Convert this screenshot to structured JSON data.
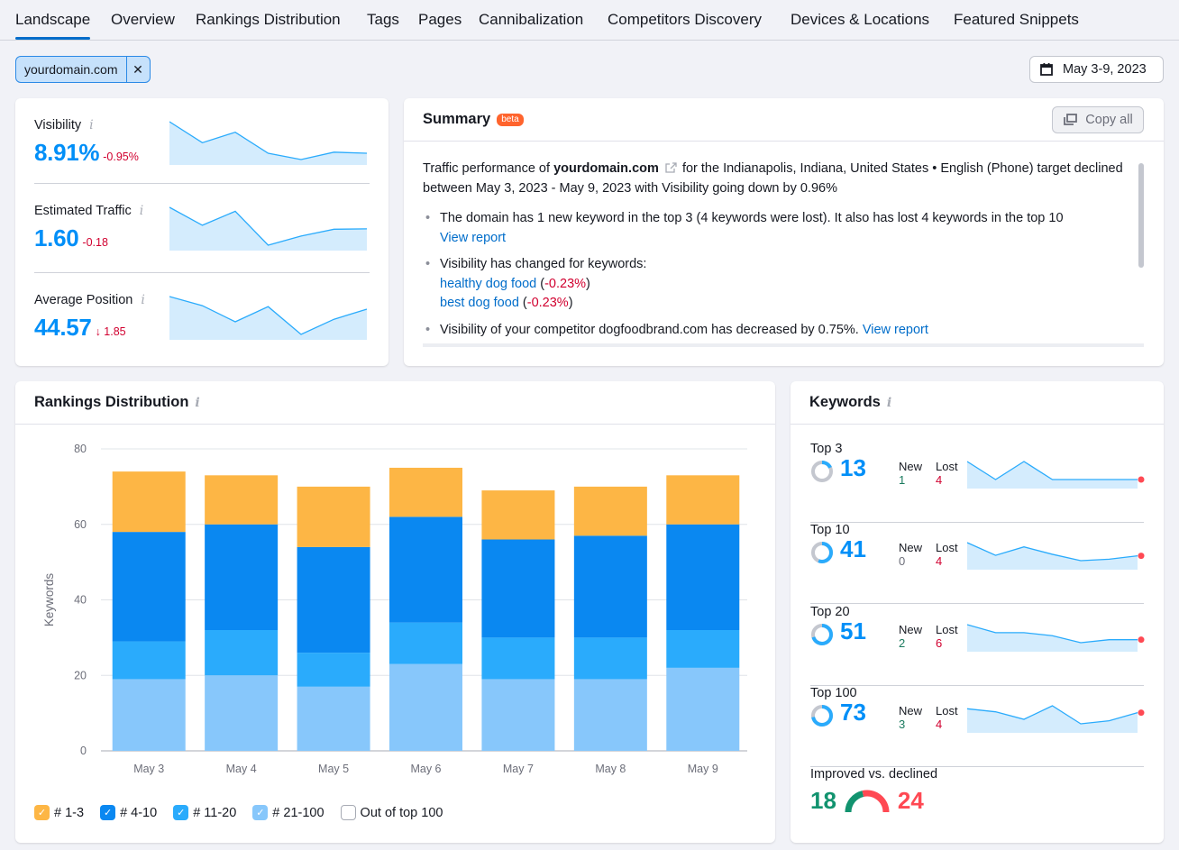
{
  "tabs": [
    {
      "label": "Landscape",
      "active": true
    },
    {
      "label": "Overview",
      "active": false
    },
    {
      "label": "Rankings Distribution",
      "active": false
    },
    {
      "label": "Tags",
      "active": false
    },
    {
      "label": "Pages",
      "active": false
    },
    {
      "label": "Cannibalization",
      "active": false
    },
    {
      "label": "Competitors Discovery",
      "active": false
    },
    {
      "label": "Devices & Locations",
      "active": false
    },
    {
      "label": "Featured Snippets",
      "active": false
    }
  ],
  "filter": {
    "domain": "yourdomain.com",
    "close_icon": "close-icon"
  },
  "date_range": {
    "label": "May 3-9, 2023",
    "icon": "calendar-icon"
  },
  "metrics": [
    {
      "label": "Visibility",
      "value": "8.91%",
      "delta": "-0.95%",
      "trend": [
        100,
        60,
        80,
        40,
        28,
        42,
        40
      ]
    },
    {
      "label": "Estimated Traffic",
      "value": "1.60",
      "delta": "-0.18",
      "trend": [
        100,
        55,
        90,
        5,
        28,
        45,
        46
      ]
    },
    {
      "label": "Average Position",
      "value": "44.57",
      "delta": "↓ 1.85",
      "trend": [
        100,
        82,
        50,
        80,
        25,
        55,
        75
      ]
    }
  ],
  "summary": {
    "title": "Summary",
    "badge": "beta",
    "copy_label": "Copy all",
    "intro_prefix": "Traffic performance of ",
    "intro_domain": "yourdomain.com",
    "intro_suffix": " for the Indianapolis, Indiana, United States • English (Phone) target declined between May 3, 2023 - May 9, 2023 with Visibility going down by 0.96%",
    "bullet1_text": "The domain has 1 new keyword in the top 3 (4 keywords were lost). It also has lost 4 keywords in the top 10",
    "bullet1_link": "View report",
    "bullet2_text": "Visibility has changed for keywords:",
    "bullet2_kw1": "healthy dog food",
    "bullet2_kw1_delta": "-0.23%",
    "bullet2_kw2": "best dog food",
    "bullet2_kw2_delta": "-0.23%",
    "bullet3_text": "Visibility of your competitor dogfoodbrand.com has decreased by 0.75%.",
    "bullet3_link": "View report"
  },
  "rankings": {
    "title": "Rankings Distribution",
    "legend": [
      {
        "label": "# 1-3",
        "color": "#fdb645",
        "checked": true
      },
      {
        "label": "# 4-10",
        "color": "#0a88f1",
        "checked": true
      },
      {
        "label": "# 11-20",
        "color": "#2aabfc",
        "checked": true
      },
      {
        "label": "# 21-100",
        "color": "#87c7fb",
        "checked": true
      },
      {
        "label": "Out of top 100",
        "color": "#ffffff",
        "checked": false
      }
    ]
  },
  "chart_data": {
    "type": "bar",
    "stacked": true,
    "title": "Rankings Distribution",
    "xlabel": "",
    "ylabel": "Keywords",
    "ylim": [
      0,
      80
    ],
    "yticks": [
      0,
      20,
      40,
      60,
      80
    ],
    "grid": true,
    "legend_position": "bottom",
    "categories": [
      "May 3",
      "May 4",
      "May 5",
      "May 6",
      "May 7",
      "May 8",
      "May 9"
    ],
    "series": [
      {
        "name": "# 21-100",
        "color": "#87c7fb",
        "values": [
          19,
          20,
          17,
          23,
          19,
          19,
          22
        ]
      },
      {
        "name": "# 11-20",
        "color": "#2aabfc",
        "values": [
          10,
          12,
          9,
          11,
          11,
          11,
          10
        ]
      },
      {
        "name": "# 4-10",
        "color": "#0a88f1",
        "values": [
          29,
          28,
          28,
          28,
          26,
          27,
          28
        ]
      },
      {
        "name": "# 1-3",
        "color": "#fdb645",
        "values": [
          16,
          13,
          16,
          13,
          13,
          13,
          13
        ]
      }
    ]
  },
  "keywords": {
    "title": "Keywords",
    "new_label": "New",
    "lost_label": "Lost",
    "rows": [
      {
        "label": "Top 3",
        "value": "13",
        "share": 0.18,
        "new": "1",
        "new_class": "green-dark",
        "lost": "4",
        "trend": [
          100,
          20,
          100,
          20,
          20,
          20,
          20
        ]
      },
      {
        "label": "Top 10",
        "value": "41",
        "share": 0.56,
        "new": "0",
        "new_class": "grey",
        "lost": "4",
        "trend": [
          100,
          40,
          80,
          45,
          15,
          22,
          38
        ]
      },
      {
        "label": "Top 20",
        "value": "51",
        "share": 0.7,
        "new": "2",
        "new_class": "green-dark",
        "lost": "6",
        "trend": [
          100,
          60,
          60,
          45,
          10,
          25,
          25
        ]
      },
      {
        "label": "Top 100",
        "value": "73",
        "share": 0.72,
        "new": "3",
        "new_class": "green-dark",
        "lost": "4",
        "trend": [
          75,
          65,
          40,
          85,
          25,
          35,
          62
        ]
      }
    ],
    "improved_label": "Improved vs. declined",
    "improved": "18",
    "declined": "24",
    "improved_color": "#12936f",
    "declined_color": "#ff4953"
  }
}
